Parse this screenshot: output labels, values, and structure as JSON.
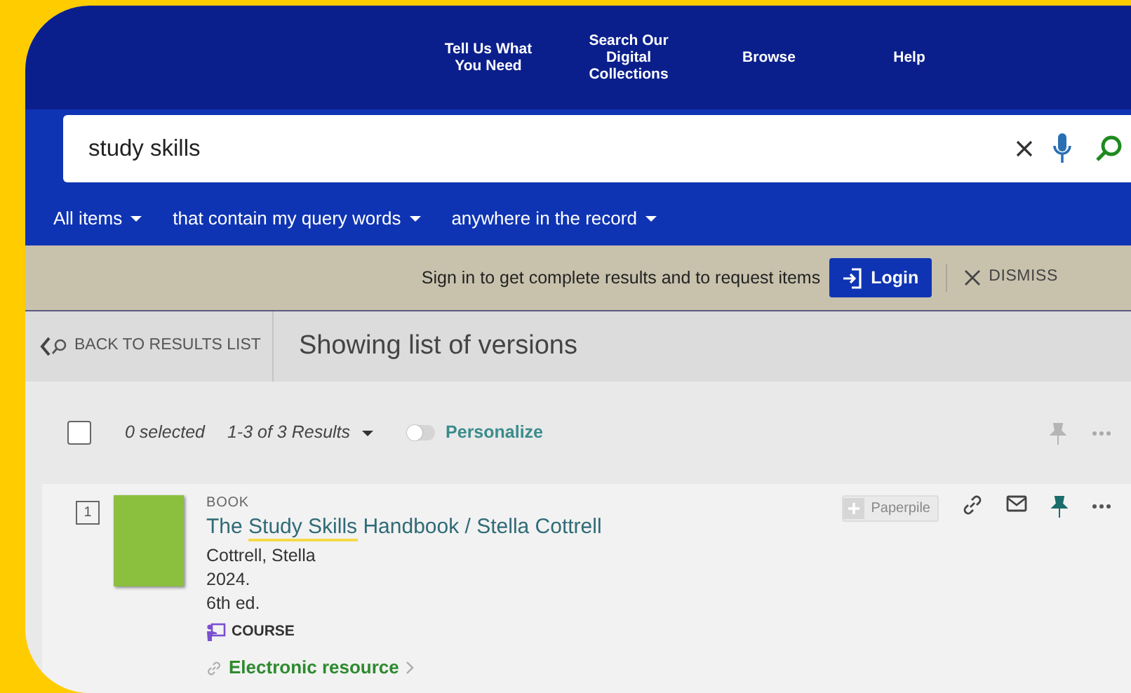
{
  "top_nav": {
    "items": [
      {
        "label": "Tell Us What You Need"
      },
      {
        "label": "Search Our Digital Collections"
      },
      {
        "label": "Browse"
      },
      {
        "label": "Help"
      }
    ]
  },
  "search": {
    "value": "study skills",
    "filters": [
      "All items",
      "that contain my query words",
      "anywhere in the record"
    ]
  },
  "signin_bar": {
    "message": "Sign in to get complete results and to request items",
    "login": "Login",
    "dismiss": "DISMISS"
  },
  "versions_bar": {
    "back": "BACK TO RESULTS LIST",
    "title": "Showing list of versions"
  },
  "toolbar": {
    "select_all_checked": false,
    "selected_count": "0 selected",
    "results": "1-3 of 3 Results",
    "personalize_on": false,
    "personalize": "Personalize"
  },
  "results": [
    {
      "number": "1",
      "type": "BOOK",
      "title": [
        {
          "text": "The ",
          "highlight": false
        },
        {
          "text": "Study Skills",
          "highlight": true
        },
        {
          "text": " Handbook / Stella Cottrell",
          "highlight": false
        }
      ],
      "author": "Cottrell, Stella",
      "year": "2024.",
      "edition": "6th ed.",
      "course": "COURSE",
      "availability": "Electronic resource",
      "paperpile": "Paperpile",
      "pinned": true
    }
  ]
}
